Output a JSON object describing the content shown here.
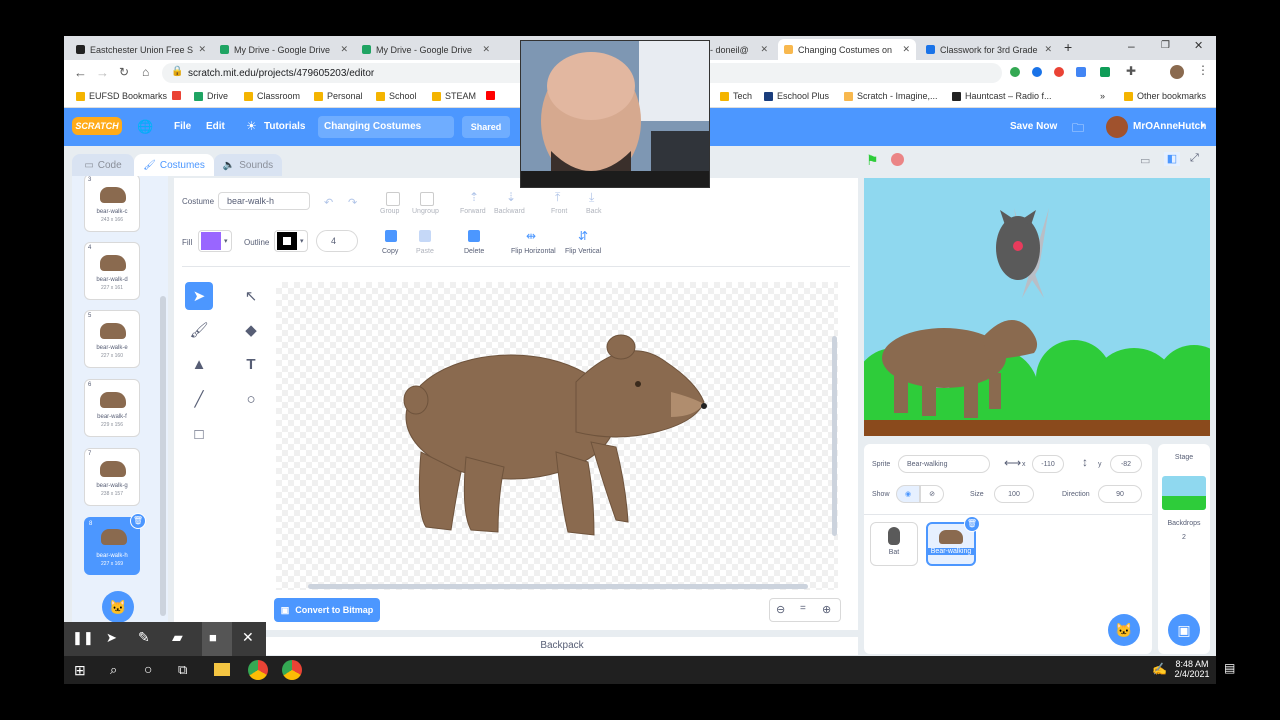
{
  "browser": {
    "tabs": [
      {
        "label": "Eastchester Union Free S",
        "favicon": "blackboard-icon",
        "color": "#222"
      },
      {
        "label": "My Drive - Google Drive",
        "favicon": "drive-icon",
        "color": "#1fa463"
      },
      {
        "label": "My Drive - Google Drive",
        "favicon": "drive-icon",
        "color": "#1fa463"
      },
      {
        "label": "- doneil@",
        "favicon": "mail-icon",
        "color": "#888"
      },
      {
        "label": "Changing Costumes on",
        "favicon": "scratch-icon",
        "color": "#f8b84e"
      },
      {
        "label": "Classwork for 3rd Grade",
        "favicon": "classroom-icon",
        "color": "#1a73e8"
      }
    ],
    "url": "scratch.mit.edu/projects/479605203/editor",
    "bookmarks": [
      "EUFSD Bookmarks",
      "Drive",
      "Classroom",
      "Personal",
      "School",
      "STEAM",
      "Tech",
      "Eschool Plus",
      "Scratch - Imagine,...",
      "Hauntcast – Radio f...",
      "Other bookmarks"
    ],
    "overflow": "»"
  },
  "menu": {
    "logo": "SCRATCH",
    "file": "File",
    "edit": "Edit",
    "tutorials": "Tutorials",
    "project_title": "Changing Costumes",
    "shared": "Shared",
    "save_now": "Save Now",
    "user": "MrOAnneHutch"
  },
  "tabs": {
    "code": "Code",
    "costumes": "Costumes",
    "sounds": "Sounds"
  },
  "costumes": [
    {
      "num": "3",
      "name": "bear-walk-c",
      "size": "243 x 166"
    },
    {
      "num": "4",
      "name": "bear-walk-d",
      "size": "227 x 161"
    },
    {
      "num": "5",
      "name": "bear-walk-e",
      "size": "227 x 160"
    },
    {
      "num": "6",
      "name": "bear-walk-f",
      "size": "229 x 156"
    },
    {
      "num": "7",
      "name": "bear-walk-g",
      "size": "238 x 157"
    },
    {
      "num": "8",
      "name": "bear-walk-h",
      "size": "227 x 169"
    }
  ],
  "paint": {
    "costume_label": "Costume",
    "costume_name": "bear-walk-h",
    "group": "Group",
    "ungroup": "Ungroup",
    "forward": "Forward",
    "backward": "Backward",
    "front": "Front",
    "back": "Back",
    "fill_label": "Fill",
    "fill_color": "#9966ff",
    "outline_label": "Outline",
    "outline_width": "4",
    "copy": "Copy",
    "paste": "Paste",
    "delete": "Delete",
    "flip_h": "Flip Horizontal",
    "flip_v": "Flip Vertical",
    "convert": "Convert to Bitmap",
    "zoom_reset": "="
  },
  "sprite": {
    "label": "Sprite",
    "name": "Bear-walking",
    "x_label": "x",
    "x": "-110",
    "y_label": "y",
    "y": "-82",
    "show_label": "Show",
    "size_label": "Size",
    "size": "100",
    "direction_label": "Direction",
    "direction": "90",
    "sprites": [
      {
        "name": "Bat"
      },
      {
        "name": "Bear-walking"
      }
    ]
  },
  "stage": {
    "label": "Stage",
    "backdrops_label": "Backdrops",
    "backdrops_count": "2"
  },
  "backpack": "Backpack",
  "taskbar": {
    "time": "8:48 AM",
    "date": "2/4/2021"
  },
  "colors": {
    "scratch_blue": "#4c97ff",
    "bear": "#8a6a4f",
    "sky": "#8fd8ef",
    "grass": "#2ecc3a"
  }
}
